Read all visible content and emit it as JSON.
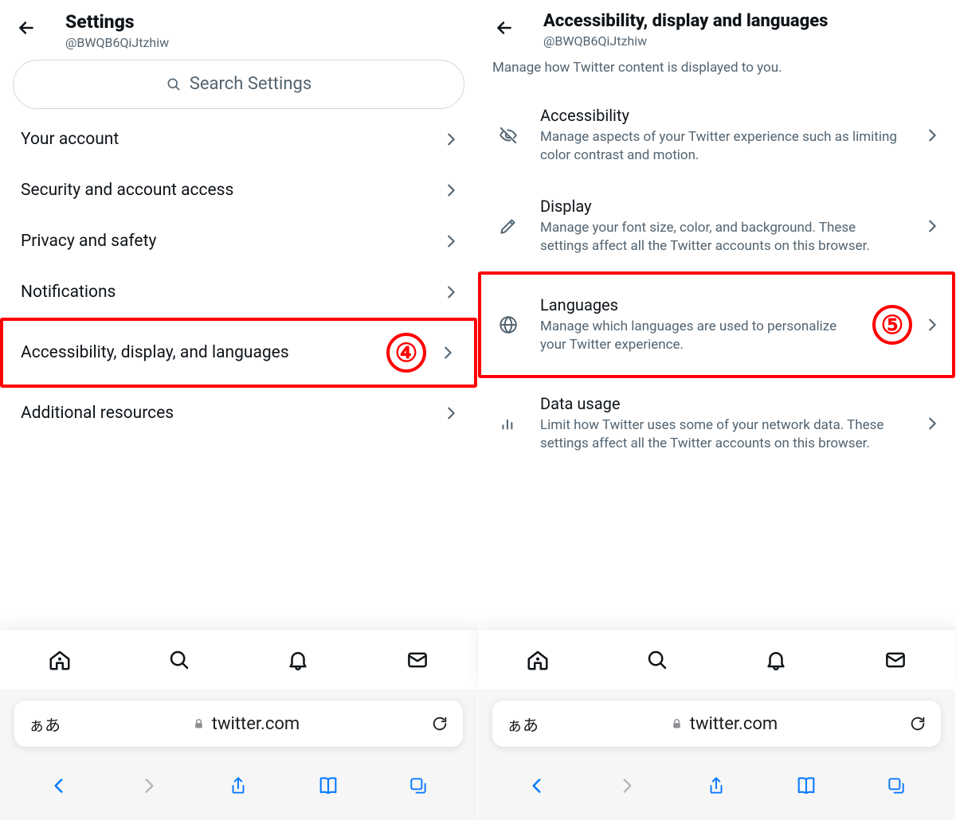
{
  "left": {
    "title": "Settings",
    "handle": "@BWQB6QiJtzhiw",
    "search_placeholder": "Search Settings",
    "items": [
      {
        "label": "Your account"
      },
      {
        "label": "Security and account access"
      },
      {
        "label": "Privacy and safety"
      },
      {
        "label": "Notifications"
      },
      {
        "label": "Accessibility, display, and languages",
        "highlight": true,
        "badge": "④"
      },
      {
        "label": "Additional resources"
      }
    ]
  },
  "right": {
    "title": "Accessibility, display and languages",
    "handle": "@BWQB6QiJtzhiw",
    "desc": "Manage how Twitter content is displayed to you.",
    "items": [
      {
        "title": "Accessibility",
        "desc": "Manage aspects of your Twitter experience such as limiting color contrast and motion."
      },
      {
        "title": "Display",
        "desc": "Manage your font size, color, and background. These settings affect all the Twitter accounts on this browser."
      },
      {
        "title": "Languages",
        "desc": "Manage which languages are used to personalize your Twitter experience.",
        "highlight": true,
        "badge": "⑤"
      },
      {
        "title": "Data usage",
        "desc": "Limit how Twitter uses some of your network data. These settings affect all the Twitter accounts on this browser."
      }
    ]
  },
  "url": "twitter.com",
  "aa": "ぁあ"
}
